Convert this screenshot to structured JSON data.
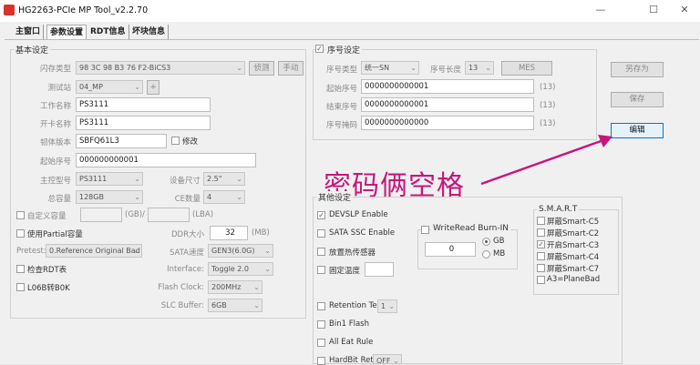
{
  "window": {
    "title": "HG2263-PCIe MP Tool_v2.2.70",
    "minimize_glyph": "—",
    "maximize_glyph": "☐",
    "close_glyph": "✕"
  },
  "tabs": [
    "主窗口",
    "参数设置",
    "RDT信息",
    "坏块信息"
  ],
  "basic": {
    "group_label": "基本设定",
    "flash_type_label": "闪存类型",
    "flash_type_value": "98 3C 98 B3 76 F2-BiCS3",
    "detect_button": "侦测",
    "manual_button": "手动",
    "test_station_label": "测试站",
    "test_station_value": "04_MP",
    "plus_button": "+",
    "work_name_label": "工作名称",
    "work_name_value": "PS3111",
    "card_name_label": "开卡名称",
    "card_name_value": "PS3111",
    "firmware_label": "韧体版本",
    "firmware_value": "SBFQ61L3",
    "modify_label": "修改",
    "start_serial_label": "起始序号",
    "start_serial_value": "000000000001",
    "controller_label": "主控型号",
    "controller_value": "PS3111",
    "device_size_label": "设备尺寸",
    "device_size_value": "2.5\"",
    "capacity_label": "总容量",
    "capacity_value": "128GB",
    "ce_label": "CE数量",
    "ce_value": "4",
    "custom_capacity_label": "自定义容量",
    "gb_unit": "(GB)/",
    "lba_unit": "(LBA)",
    "partial_label": "使用Partial容量",
    "ddr_label": "DDR大小",
    "ddr_value": "32",
    "ddr_unit": "(MB)",
    "pretest_label": "Pretest:",
    "pretest_value": "0.Reference Original Bad",
    "sata_speed_label": "SATA速度",
    "sata_speed_value": "GEN3(6.0G)",
    "check_rdt_label": "检查RDT表",
    "interface_label": "Interface:",
    "interface_value": "Toggle 2.0",
    "l06b_label": "L06B转B0K",
    "flash_clock_label": "Flash Clock:",
    "flash_clock_value": "200MHz",
    "slc_buffer_label": "SLC Buffer:",
    "slc_buffer_value": "6GB"
  },
  "serial": {
    "group_label": "序号设定",
    "type_label": "序号类型",
    "type_value": "统一SN",
    "length_label": "序号长度",
    "length_value": "13",
    "mes_button": "MES",
    "start_label": "起始序号",
    "start_value": "0000000000001",
    "start_count": "(13)",
    "end_label": "结束序号",
    "end_value": "0000000000001",
    "end_count": "(13)",
    "mask_label": "序号掩码",
    "mask_value": "0000000000000",
    "mask_count": "(13)"
  },
  "side_buttons": {
    "save_as": "另存为",
    "save": "保存",
    "edit": "编辑"
  },
  "annotation": "密码俩空格",
  "other": {
    "group_label": "其他设定",
    "devslp": "DEVSLP Enable",
    "sata_ssc": "SATA SSC Enable",
    "thermal": "放置热传感器",
    "fixed_temp": "固定温度",
    "write_read_label": "WriteRead Burn-IN",
    "write_read_value": "0",
    "gb_option": "GB",
    "mb_option": "MB",
    "retention_label": "Retention Test",
    "retention_value": "1",
    "bin1": "Bin1 Flash",
    "all_eat": "All Eat Rule",
    "hardbit_label": "HardBit Retry",
    "hardbit_value": "OFF"
  },
  "smart": {
    "group_label": "S.M.A.R.T",
    "items": [
      "屏蔽Smart-C5",
      "屏蔽Smart-C2",
      "开启Smart-C3",
      "屏蔽Smart-C4",
      "屏蔽Smart-C7",
      "A3=PlaneBad"
    ]
  }
}
